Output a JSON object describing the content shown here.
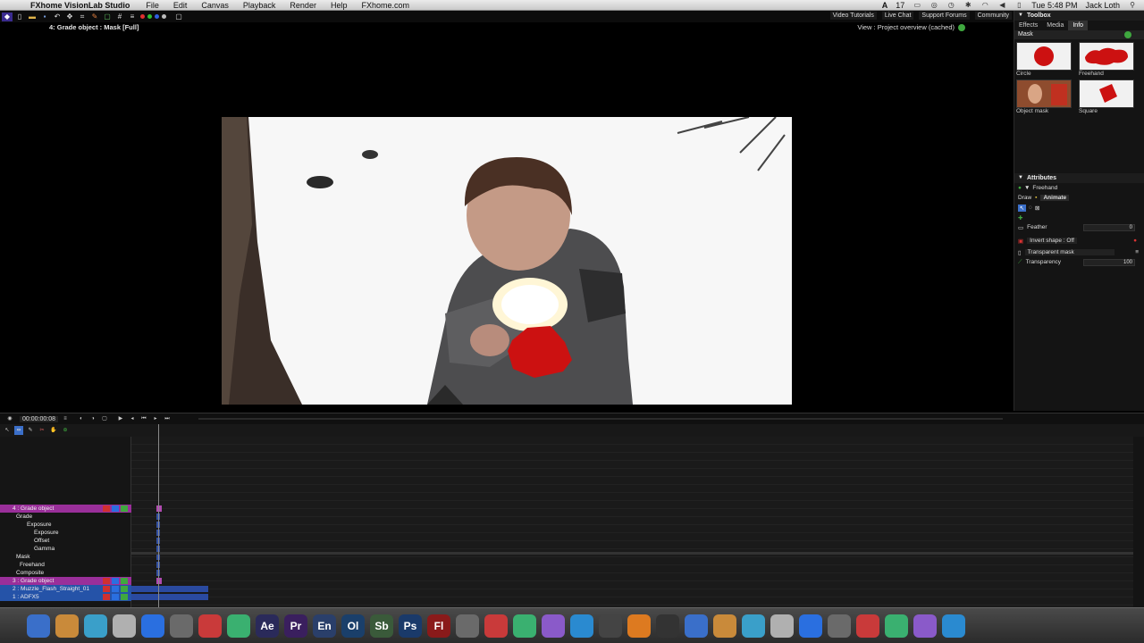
{
  "menubar": {
    "app_name": "FXhome VisionLab Studio",
    "menus": [
      "File",
      "Edit",
      "Canvas",
      "Playback",
      "Render",
      "Help",
      "FXhome.com"
    ],
    "status": {
      "battery_count": "17",
      "clock": "Tue 5:48 PM",
      "user": "Jack Loth"
    }
  },
  "toolbar": {
    "links": [
      "Video Tutorials",
      "Live Chat",
      "Support Forums",
      "Community"
    ]
  },
  "viewer": {
    "title": "4: Grade object : Mask [Full]",
    "view_status": "View : Project overview (cached)"
  },
  "toolbox": {
    "title": "Toolbox",
    "tabs": [
      "Effects",
      "Media",
      "Info"
    ],
    "active_tab": "Info",
    "section": "Mask",
    "items": [
      {
        "label": "Circle"
      },
      {
        "label": "Freehand"
      },
      {
        "label": "Object mask"
      },
      {
        "label": "Square"
      }
    ]
  },
  "attributes": {
    "title": "Attributes",
    "selected": "Freehand",
    "modes": [
      "Draw",
      "Animate"
    ],
    "feather_label": "Feather",
    "feather_value": "0",
    "invert_label": "Invert shape : Off",
    "transparent_mask_label": "Transparent mask",
    "transparency_label": "Transparency",
    "transparency_value": "100"
  },
  "timeline": {
    "timecode": "00:00:00:08",
    "tracks": [
      {
        "label": "4 : Grade object",
        "color": "magenta"
      },
      {
        "label": "Grade",
        "color": "none"
      },
      {
        "label": "Exposure",
        "color": "none"
      },
      {
        "label": "Exposure",
        "color": "none"
      },
      {
        "label": "Offset",
        "color": "none"
      },
      {
        "label": "Gamma",
        "color": "none"
      },
      {
        "label": "Mask",
        "color": "none"
      },
      {
        "label": "Freehand",
        "color": "none"
      },
      {
        "label": "Composite",
        "color": "none"
      },
      {
        "label": "3 : Grade object",
        "color": "magenta"
      },
      {
        "label": "2 : Muzzle_Flash_Straight_01",
        "color": "blue"
      },
      {
        "label": "1 : ADFX5",
        "color": "blue"
      }
    ]
  },
  "dock": {
    "labeled_icons": [
      "Ae",
      "Pr",
      "En",
      "Ol",
      "Sb",
      "Ps",
      "Fl"
    ]
  },
  "colors": {
    "accent_magenta": "#9a2f9a",
    "accent_blue": "#2553a8",
    "mask_red": "#cc1111",
    "ok_green": "#3fa83f"
  }
}
